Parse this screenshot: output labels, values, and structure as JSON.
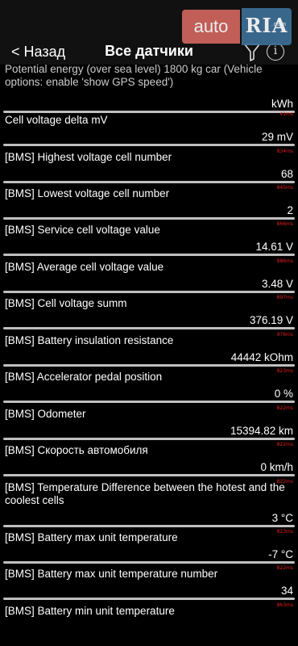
{
  "nav": {
    "back_label": "< Назад",
    "title": "Все датчики"
  },
  "watermark": {
    "auto": "auto",
    "ria": "RIA",
    "com": ".com"
  },
  "sensors": [
    {
      "label": "Potential energy (over sea level) 1800 kg car (Vehicle options: enable 'show GPS speed')",
      "value": "kWh",
      "ms": ""
    },
    {
      "label": "Cell voltage delta mV",
      "value": "29 mV",
      "ms": "41ms"
    },
    {
      "label": "[BMS] Highest voltage cell number",
      "value": "68",
      "ms": "834ms"
    },
    {
      "label": "[BMS] Lowest voltage cell number",
      "value": "2",
      "ms": "845ms"
    },
    {
      "label": "[BMS] Service cell voltage value",
      "value": "14.61 V",
      "ms": "866ms"
    },
    {
      "label": "[BMS] Average cell voltage value",
      "value": "3.48 V",
      "ms": "886ms"
    },
    {
      "label": "[BMS] Cell voltage summ",
      "value": "376.19 V",
      "ms": "897ms"
    },
    {
      "label": "[BMS] Battery insulation resistance",
      "value": "44442 kOhm",
      "ms": "976ms"
    },
    {
      "label": "[BMS] Accelerator pedal position",
      "value": "0 %",
      "ms": "823ms"
    },
    {
      "label": "[BMS] Odometer",
      "value": "15394.82 km",
      "ms": "822ms"
    },
    {
      "label": "[BMS] Скорость автомобиля",
      "value": "0 km/h",
      "ms": "822ms"
    },
    {
      "label": "[BMS] Temperature Difference between the hotest and the coolest cells",
      "value": "3 °C",
      "ms": "822ms"
    },
    {
      "label": "[BMS] Battery max unit temperature",
      "value": "-7 °C",
      "ms": "823ms"
    },
    {
      "label": "[BMS] Battery max unit temperature number",
      "value": "34",
      "ms": "822ms"
    },
    {
      "label": "[BMS] Battery min unit temperature",
      "value": "",
      "ms": "863ms"
    }
  ]
}
